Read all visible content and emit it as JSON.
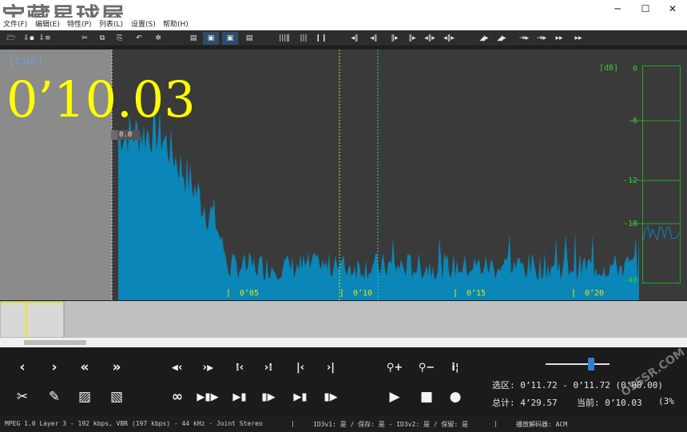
{
  "window": {
    "watermark": "宝藏星球屋",
    "minimize": "─",
    "maximize": "☐",
    "close": "✕"
  },
  "menu": [
    "文件(F)",
    "编辑(E)",
    "特性(P)",
    "列表(L)",
    "设置(S)",
    "帮助(H)"
  ],
  "toolbar": {
    "groups": [
      {
        "icon": "open-folder-icon",
        "glyph": "🗁"
      },
      {
        "icon": "import-icon",
        "glyph": "⇩▪"
      },
      {
        "icon": "export-icon",
        "glyph": "⇩≡"
      },
      {
        "icon": "cut-icon",
        "glyph": "✂"
      },
      {
        "icon": "copy-icon",
        "glyph": "⧉"
      },
      {
        "icon": "paste-icon",
        "glyph": "⎘"
      },
      {
        "icon": "undo-icon",
        "glyph": "↶"
      },
      {
        "icon": "settings-icon",
        "glyph": "✲"
      },
      {
        "icon": "file-icon",
        "glyph": "▤"
      },
      {
        "icon": "file-a-icon",
        "glyph": "▣"
      },
      {
        "icon": "file-b-icon",
        "glyph": "▣"
      },
      {
        "icon": "file-c-icon",
        "glyph": "▤"
      },
      {
        "icon": "frames-icon",
        "glyph": "|||‖"
      },
      {
        "icon": "frames-2-icon",
        "glyph": "|||"
      },
      {
        "icon": "pause-bars-icon",
        "glyph": "❙❙"
      },
      {
        "icon": "marker-1-icon",
        "glyph": "◂‖"
      },
      {
        "icon": "marker-2-icon",
        "glyph": "◂‖"
      },
      {
        "icon": "marker-3-icon",
        "glyph": "‖▸"
      },
      {
        "icon": "marker-4-icon",
        "glyph": "‖▸"
      },
      {
        "icon": "marker-5-icon",
        "glyph": "◂‖▸"
      },
      {
        "icon": "marker-6-icon",
        "glyph": "◂‖▸"
      },
      {
        "icon": "fade-1-icon",
        "glyph": "◢▸"
      },
      {
        "icon": "fade-2-icon",
        "glyph": "◢▸"
      },
      {
        "icon": "fade-3-icon",
        "glyph": "⇥▸"
      },
      {
        "icon": "fade-4-icon",
        "glyph": "⇥▸"
      },
      {
        "icon": "fade-5-icon",
        "glyph": "▸▸"
      },
      {
        "icon": "fade-6-icon",
        "glyph": "▸▸"
      }
    ]
  },
  "waveform": {
    "cue_label": "[cue]",
    "time_display": "0’10.03",
    "marker_value": "0.0",
    "time_ticks": [
      "0’05",
      "0’10",
      "0’15",
      "0’20"
    ],
    "db_unit": "[dB]",
    "db_ticks": [
      "0",
      "-6",
      "-12",
      "-18",
      "-48"
    ],
    "wave_color": "#0a86b8",
    "cursor_color": "#e8e800",
    "selection_color": "#50b0d0"
  },
  "controls": {
    "row1": [
      {
        "name": "prev-button",
        "glyph": "‹"
      },
      {
        "name": "next-button",
        "glyph": "›"
      },
      {
        "name": "rewind-button",
        "glyph": "«"
      },
      {
        "name": "fast-forward-button",
        "glyph": "»"
      },
      {
        "name": "select-start-button",
        "glyph": "⫷‹"
      },
      {
        "name": "select-end-button",
        "glyph": "›⫸"
      },
      {
        "name": "split-left-button",
        "glyph": "⁞‹"
      },
      {
        "name": "split-right-button",
        "glyph": "›⁞"
      },
      {
        "name": "go-start-button",
        "glyph": "|‹"
      },
      {
        "name": "go-end-button",
        "glyph": "›|"
      },
      {
        "name": "zoom-in-button",
        "glyph": "⚲+"
      },
      {
        "name": "zoom-out-button",
        "glyph": "⚲−"
      },
      {
        "name": "info-button",
        "glyph": "i¦"
      }
    ],
    "row2": [
      {
        "name": "cut-tool-button",
        "glyph": "✂"
      },
      {
        "name": "pencil-tool-button",
        "glyph": "✎"
      },
      {
        "name": "hatch-1-button",
        "glyph": "▨"
      },
      {
        "name": "hatch-2-button",
        "glyph": "▧"
      },
      {
        "name": "loop-button",
        "glyph": "∞"
      },
      {
        "name": "play-selection-button",
        "glyph": "▶▮▶"
      },
      {
        "name": "play-to-end-button",
        "glyph": "▶▮"
      },
      {
        "name": "play-from-start-button",
        "glyph": "▮▶"
      },
      {
        "name": "play-region-button",
        "glyph": "▶▮"
      },
      {
        "name": "play-after-button",
        "glyph": "▮▶"
      },
      {
        "name": "play-button",
        "glyph": "▶"
      },
      {
        "name": "stop-button",
        "glyph": "■"
      },
      {
        "name": "record-button",
        "glyph": "●"
      }
    ]
  },
  "info": {
    "selection": "选区: 0’11.72 - 0’11.72 (0’00.00)",
    "total": "总计: 4’29.57",
    "current": "当前: 0’10.03",
    "zoom": "(3%"
  },
  "status": {
    "format": "MPEG 1.0 Layer 3  -  192 kbps, VBR (197 kbps)  -  44 kHz  -  Joint Stereo",
    "id3": "ID3v1: 是 / 保存: 是  -  ID3v2: 是 / 保留: 是",
    "decoder": "播放解码器: ACM",
    "site": "OSSSR.COM"
  }
}
